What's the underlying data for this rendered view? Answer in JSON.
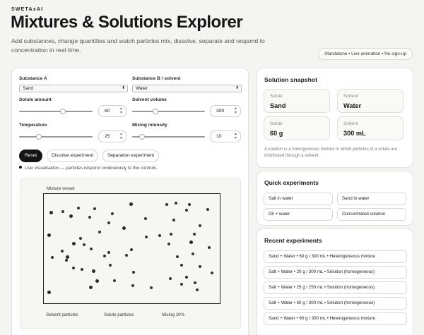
{
  "brand": "SWETAxAI",
  "title": "Mixtures & Solutions Explorer",
  "subtitle": "Add substances, change quantities and watch particles mix, dissolve, separate and respond to concentration in real time.",
  "badge": "Standalone • Live animation • No sign-up",
  "controls": {
    "substance_a": {
      "label": "Substance A",
      "value": "Sand"
    },
    "substance_b": {
      "label": "Substance B / solvent",
      "value": "Water"
    },
    "solute_amount": {
      "label": "Solute amount",
      "value": "60",
      "level": 0.6
    },
    "solvent_volume": {
      "label": "Solvent volume",
      "value": "300",
      "level": 0.3
    },
    "temperature": {
      "label": "Temperature",
      "value": "25",
      "level": 0.25
    },
    "mixing_intensity": {
      "label": "Mixing intensity",
      "value": "10",
      "level": 0.1
    }
  },
  "buttons": {
    "reset": "Reset",
    "dissolve": "Dissolve experiment",
    "separation": "Separation experiment"
  },
  "live_text": "Live visualisation — particles respond continuously to the controls.",
  "visual": {
    "vessel_label": "Mixture vessel",
    "solvent_label": "Solvent particles",
    "solute_label": "Solute particles",
    "mixing_label": "Mixing 10%"
  },
  "snapshot": {
    "title": "Solution snapshot",
    "cells": [
      {
        "key": "Solute",
        "value": "Sand"
      },
      {
        "key": "Solvent",
        "value": "Water"
      },
      {
        "key": "Solute",
        "value": "60 g"
      },
      {
        "key": "Solvent",
        "value": "300 mL"
      }
    ],
    "note": "A solution is a homogeneous mixture in which particles of a solute are distributed through a solvent."
  },
  "quick": {
    "title": "Quick experiments",
    "items": [
      "Salt in water",
      "Sand in water",
      "Oil + water",
      "Concentrated solution"
    ]
  },
  "recent": {
    "title": "Recent experiments",
    "items": [
      "Sand + Water • 60 g / 300 mL • Heterogeneous mixture",
      "Salt + Water • 20 g / 300 mL • Solution (homogeneous)",
      "Salt + Water • 25 g / 250 mL • Solution (homogeneous)",
      "Salt + Water • 60 g / 300 mL • Solution (homogeneous)",
      "Sand + Water • 60 g / 300 mL • Heterogeneous mixture"
    ]
  },
  "colors": {
    "primary_button": "#141414",
    "particle": "#333333"
  }
}
